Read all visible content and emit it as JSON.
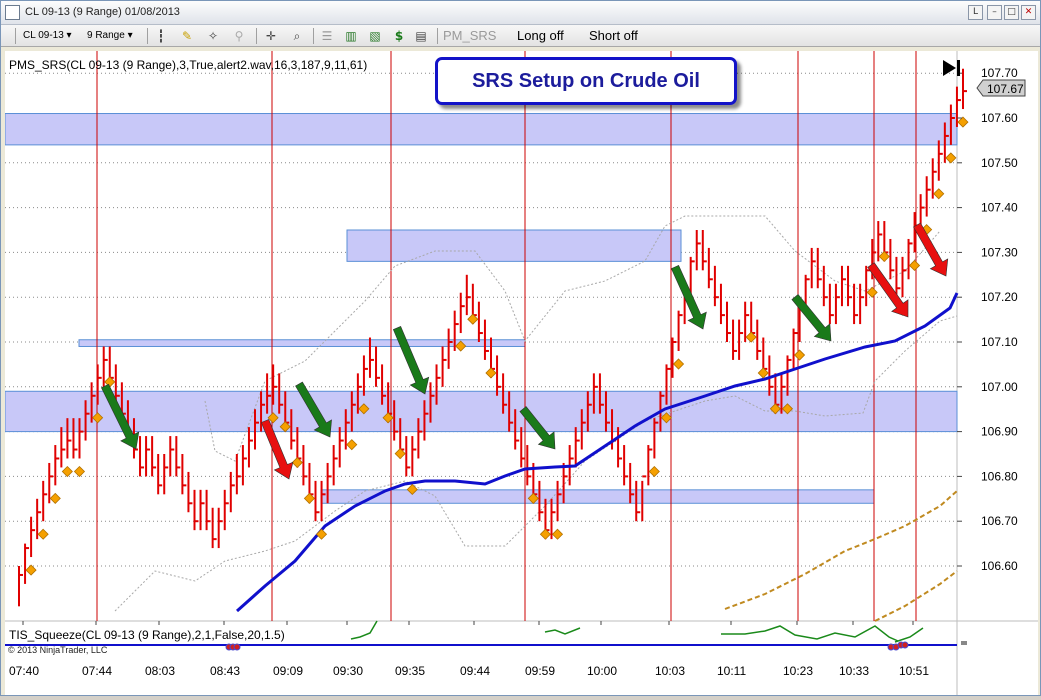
{
  "window": {
    "title": "CL 09-13 (9 Range)  01/08/2013",
    "buttons": [
      "L",
      "–",
      "□",
      "✕"
    ]
  },
  "toolbar": {
    "instrument": "CL 09-13",
    "period": "9 Range",
    "pms_label": "PM_SRS",
    "long_label": "Long off",
    "short_label": "Short off"
  },
  "callout": {
    "text": "SRS Setup on Crude Oil"
  },
  "price_panel": {
    "indicator_label": "PMS_SRS(CL 09-13 (9 Range),3,True,alert2.wav,16,3,187,9,11,61)",
    "current_price": "107.67",
    "y_ticks": [
      "107.70",
      "107.60",
      "107.50",
      "107.40",
      "107.30",
      "107.20",
      "107.10",
      "107.00",
      "106.90",
      "106.80",
      "106.70",
      "106.60"
    ]
  },
  "lower_panel": {
    "indicator_label": "TIS_Squeeze(CL 09-13 (9 Range),2,1,False,20,1.5)",
    "copyright": "© 2013 NinjaTrader, LLC"
  },
  "x_ticks": [
    "07:40",
    "07:44",
    "08:03",
    "08:43",
    "09:09",
    "09:30",
    "09:35",
    "09:44",
    "09:59",
    "10:00",
    "10:03",
    "10:11",
    "10:23",
    "10:33",
    "10:51"
  ],
  "colors": {
    "bars": "#e00000",
    "ma": "#1010cc",
    "zone": "#c8c8f8",
    "zone_border": "#5a8fd6",
    "diamond": "#f5a000",
    "long_arrow": "#1a7a1a",
    "short_arrow": "#e81010",
    "squeeze_line": "#1a8a1a",
    "dashed": "#c08a20",
    "session_line": "#cc0000"
  },
  "icons": [
    "window-icon",
    "bar-style-icon",
    "pencil-icon",
    "crosshair-icon",
    "zoom-icon",
    "data-box-icon",
    "candles-icon",
    "chart-style-icon",
    "dollar-icon",
    "properties-icon"
  ]
}
